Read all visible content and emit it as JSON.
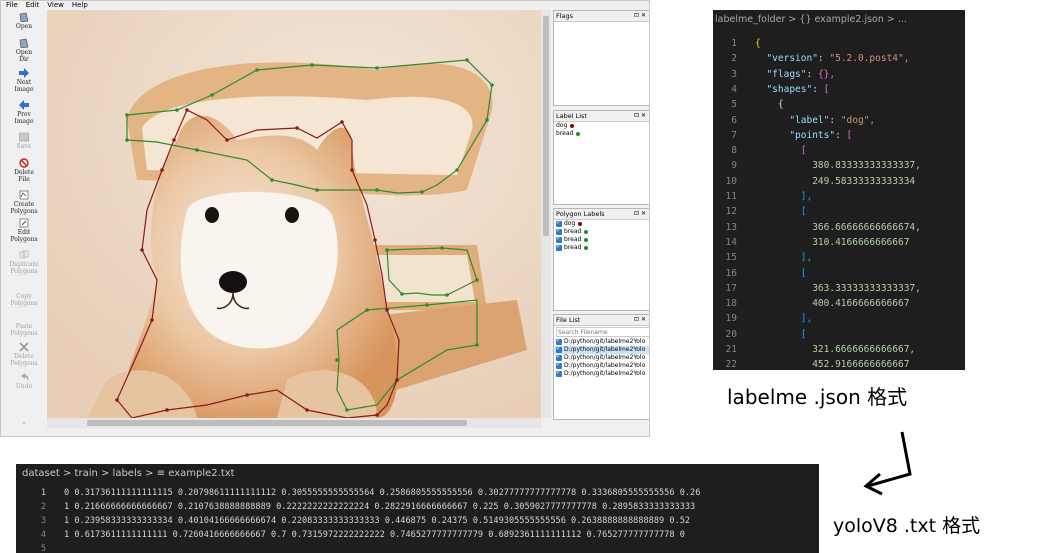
{
  "labelme": {
    "menu": [
      "File",
      "Edit",
      "View",
      "Help"
    ],
    "tools": [
      {
        "icon": "open-icon",
        "label": "Open",
        "enabled": true
      },
      {
        "icon": "open-dir-icon",
        "label": "Open\nDir",
        "enabled": true
      },
      {
        "icon": "next-image-icon",
        "label": "Next\nImage",
        "enabled": true
      },
      {
        "icon": "prev-image-icon",
        "label": "Prev\nImage",
        "enabled": true
      },
      {
        "icon": "save-icon",
        "label": "Save",
        "enabled": false
      },
      {
        "icon": "delete-file-icon",
        "label": "Delete\nFile",
        "enabled": true
      },
      {
        "icon": "create-polygons-icon",
        "label": "Create\nPolygons",
        "enabled": true
      },
      {
        "icon": "edit-polygons-icon",
        "label": "Edit\nPolygons",
        "enabled": true
      },
      {
        "icon": "duplicate-polygons-icon",
        "label": "Duplicate\nPolygons",
        "enabled": false
      },
      {
        "icon": "copy-polygons-icon",
        "label": "Copy\nPolygons",
        "enabled": false
      },
      {
        "icon": "paste-polygons-icon",
        "label": "Paste\nPolygons",
        "enabled": false
      },
      {
        "icon": "delete-polygons-icon",
        "label": "Delete\nPolygons",
        "enabled": false
      },
      {
        "icon": "undo-icon",
        "label": "Undo",
        "enabled": false
      }
    ],
    "flags_title": "Flags",
    "label_list": {
      "title": "Label List",
      "items": [
        {
          "label": "dog",
          "color": "#8b0000"
        },
        {
          "label": "bread",
          "color": "#228b22"
        }
      ]
    },
    "polygon_labels": {
      "title": "Polygon Labels",
      "items": [
        {
          "label": "dog",
          "color": "#8b0000"
        },
        {
          "label": "bread",
          "color": "#228b22"
        },
        {
          "label": "bread",
          "color": "#228b22"
        },
        {
          "label": "bread",
          "color": "#228b22"
        }
      ]
    },
    "file_list": {
      "title": "File List",
      "search_placeholder": "Search Filename",
      "files": [
        "D:/python/git/labelme2Yolo",
        "D:/python/git/labelme2Yolo",
        "D:/python/git/labelme2Yolo",
        "D:/python/git/labelme2Yolo",
        "D:/python/git/labelme2Yolo"
      ]
    },
    "dock_controls": "⊡ ✕",
    "colors": {
      "dog": "#8b1a1a",
      "bread": "#2e8b2e"
    }
  },
  "json_editor": {
    "breadcrumb": "labelme_folder > {} example2.json > ...",
    "caption": "labelme .json 格式",
    "lines": [
      {
        "n": "1",
        "t": "{"
      },
      {
        "n": "2",
        "t": "  \"version\": \"5.2.0.post4\","
      },
      {
        "n": "3",
        "t": "  \"flags\": {},"
      },
      {
        "n": "4",
        "t": "  \"shapes\": ["
      },
      {
        "n": "5",
        "t": "    {"
      },
      {
        "n": "6",
        "t": "      \"label\": \"dog\","
      },
      {
        "n": "7",
        "t": "      \"points\": ["
      },
      {
        "n": "8",
        "t": "        ["
      },
      {
        "n": "9",
        "t": "          380.83333333333337,"
      },
      {
        "n": "10",
        "t": "          249.58333333333334"
      },
      {
        "n": "11",
        "t": "        ],"
      },
      {
        "n": "12",
        "t": "        ["
      },
      {
        "n": "13",
        "t": "          366.66666666666674,"
      },
      {
        "n": "14",
        "t": "          310.4166666666667"
      },
      {
        "n": "15",
        "t": "        ],"
      },
      {
        "n": "16",
        "t": "        ["
      },
      {
        "n": "17",
        "t": "          363.33333333333337,"
      },
      {
        "n": "18",
        "t": "          400.4166666666667"
      },
      {
        "n": "19",
        "t": "        ],"
      },
      {
        "n": "20",
        "t": "        ["
      },
      {
        "n": "21",
        "t": "          321.6666666666667,"
      },
      {
        "n": "22",
        "t": "          452.9166666666667"
      }
    ]
  },
  "txt_editor": {
    "breadcrumb": "dataset > train > labels > ≡ example2.txt",
    "caption": "yoloV8 .txt 格式",
    "lines": [
      {
        "n": "1",
        "t": "0 0.31736111111111115 0.20798611111111112 0.3055555555555564 0.2586805555555556 0.30277777777777778 0.3336805555555556 0.26"
      },
      {
        "n": "2",
        "t": "1 0.21666666666666667 0.2107638888888889 0.2222222222222224 0.2822916666666667 0.225 0.3059027777777778 0.2895833333333333"
      },
      {
        "n": "3",
        "t": "1 0.23958333333333334 0.40104166666666674 0.22083333333333333 0.446875 0.24375 0.5149305555555556 0.2638888888888889 0.52"
      },
      {
        "n": "4",
        "t": "1 0.6173611111111111 0.7260416666666667 0.7 0.7315972222222222 0.7465277777777779 0.6892361111111112 0.765277777777778 0"
      },
      {
        "n": "5",
        "t": ""
      }
    ]
  }
}
